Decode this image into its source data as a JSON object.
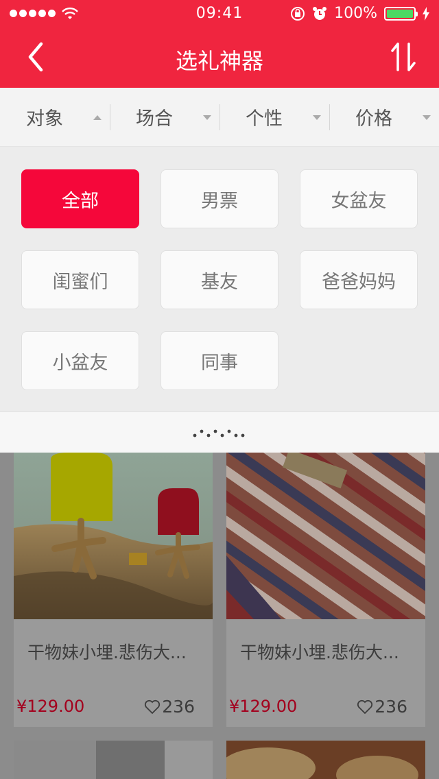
{
  "status_bar": {
    "time": "09:41",
    "battery": "100%"
  },
  "nav": {
    "title": "选礼神器"
  },
  "filters": [
    {
      "label": "对象",
      "arrow": "up"
    },
    {
      "label": "场合",
      "arrow": "down"
    },
    {
      "label": "个性",
      "arrow": "down"
    },
    {
      "label": "价格",
      "arrow": "down"
    }
  ],
  "options": {
    "items": [
      "全部",
      "男票",
      "女盆友",
      "闺蜜们",
      "基友",
      "爸爸妈妈",
      "小盆友",
      "同事"
    ],
    "selected": "全部"
  },
  "products": [
    {
      "title": "干物妹小埋.悲伤大...",
      "price": "¥129.00",
      "likes": "236"
    },
    {
      "title": "干物妹小埋.悲伤大...",
      "price": "¥129.00",
      "likes": "236"
    }
  ],
  "colors": {
    "brand_red": "#f0253f",
    "chip_active": "#f5073a",
    "price_red": "#a3001d"
  },
  "icons": [
    "back-arrow-icon",
    "sort-icon",
    "heart-icon",
    "wifi-icon",
    "battery-icon",
    "lock-rotation-icon",
    "alarm-icon",
    "charging-icon",
    "drag-handle-icon"
  ]
}
